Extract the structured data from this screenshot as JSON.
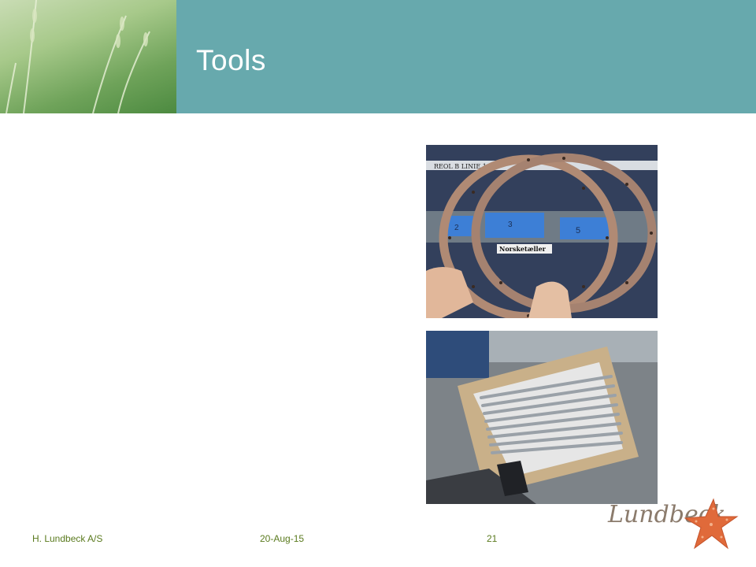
{
  "slide": {
    "title": "Tools"
  },
  "footer": {
    "company": "H. Lundbeck A/S",
    "date": "20-Aug-15",
    "page_number": "21"
  },
  "photo_rings": {
    "shelf_label_top": "REOL  B  LINIE 1.5.",
    "bin_numbers": [
      "2",
      "3",
      "5"
    ],
    "shelf_tag": "Norsketæller"
  },
  "logo": {
    "wordmark": "Lundbeck"
  },
  "colors": {
    "header": "#67a9ad",
    "footer_text": "#5a7a1e",
    "logo_text": "#8b7b6c",
    "starfish": "#e06a3a"
  }
}
